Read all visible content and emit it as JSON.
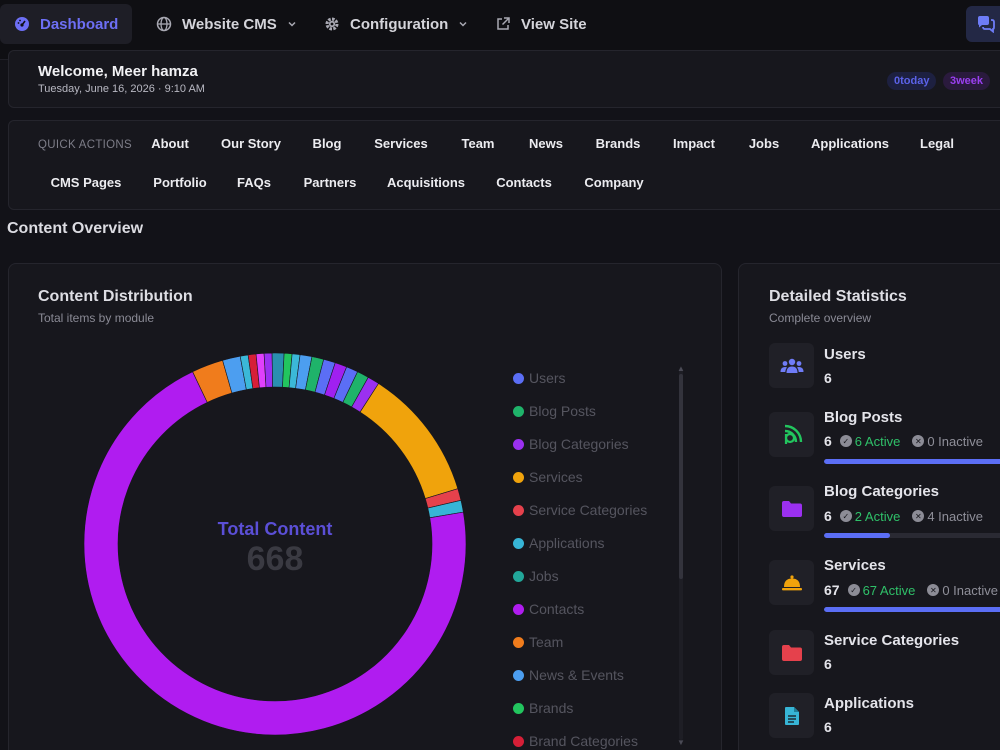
{
  "nav": {
    "items": [
      {
        "label": "Dashboard",
        "icon": "gauge-icon"
      },
      {
        "label": "Website CMS",
        "icon": "globe-icon"
      },
      {
        "label": "Configuration",
        "icon": "gear-icon"
      },
      {
        "label": "View Site",
        "icon": "external-link-icon"
      }
    ],
    "chat_icon": "comments-icon"
  },
  "welcome": {
    "name": "Welcome, Meer hamza",
    "date": "Tuesday, June 16, 2026 · 9:10 AM",
    "badges": {
      "today": "0today",
      "week": "3week"
    }
  },
  "quick_actions": {
    "label": "QUICK ACTIONS",
    "row1": [
      "About",
      "Our Story",
      "Blog",
      "Services",
      "Team",
      "News",
      "Brands",
      "Impact",
      "Jobs",
      "Applications",
      "Legal"
    ],
    "row2": [
      "CMS Pages",
      "Portfolio",
      "FAQs",
      "Partners",
      "Acquisitions",
      "Contacts",
      "Company"
    ]
  },
  "section_title": "Content Overview",
  "distribution": {
    "title": "Content Distribution",
    "subtitle": "Total items by module",
    "center_label": "Total Content",
    "center_value": "668"
  },
  "chart_data": {
    "type": "pie",
    "categories": [
      "Users",
      "Blog Posts",
      "Blog Categories",
      "Services",
      "Service Categories",
      "Applications",
      "Jobs",
      "Contacts",
      "Team",
      "News & Events",
      "Brands",
      "Brand Categories"
    ],
    "visible_legend": [
      "Users",
      "Blog Posts",
      "Blog Categories",
      "Services",
      "Service Categories",
      "Applications",
      "Jobs",
      "Contacts",
      "Team",
      "News & Events",
      "Brands",
      "Brand Categories"
    ],
    "legend_colors": [
      "#5b6ef5",
      "#1fb36a",
      "#9b30f0",
      "#f0a30c",
      "#e5414c",
      "#37b5d6",
      "#22a79a",
      "#b01cf0",
      "#f07c1c",
      "#4c9ef0",
      "#22c55e",
      "#d61f37"
    ],
    "segments": [
      {
        "value": 6,
        "color": "#5b6ef5"
      },
      {
        "value": 6,
        "color": "#1fb36a"
      },
      {
        "value": 6,
        "color": "#9b30f0"
      },
      {
        "value": 67,
        "color": "#f0a30c"
      },
      {
        "value": 6,
        "color": "#e5414c"
      },
      {
        "value": 6,
        "color": "#37b5d6"
      },
      {
        "value": 422,
        "color": "#b01cf0"
      },
      {
        "value": 16,
        "color": "#f07c1c"
      },
      {
        "value": 9,
        "color": "#4c9ef0"
      },
      {
        "value": 4,
        "color": "#3bb8d8"
      },
      {
        "value": 4,
        "color": "#d61f37"
      },
      {
        "value": 4,
        "color": "#e040fb"
      },
      {
        "value": 4,
        "color": "#9b30f0"
      },
      {
        "value": 6,
        "color": "#2a8fb0"
      },
      {
        "value": 4,
        "color": "#22c55e"
      },
      {
        "value": 4,
        "color": "#3bb8d8"
      },
      {
        "value": 6,
        "color": "#4c9ef0"
      },
      {
        "value": 6,
        "color": "#1fb36a"
      },
      {
        "value": 6,
        "color": "#5b6ef5"
      },
      {
        "value": 6,
        "color": "#a020f0"
      }
    ]
  },
  "stats": {
    "title": "Detailed Statistics",
    "subtitle": "Complete overview",
    "items": [
      {
        "name": "Users",
        "value": "6",
        "icon": "users-icon",
        "icon_color": "#6f7cf7"
      },
      {
        "name": "Blog Posts",
        "value": "6",
        "active": "6 Active",
        "inactive": "0 Inactive",
        "progress": 1.0,
        "icon": "blog-icon",
        "icon_color": "#22c55e"
      },
      {
        "name": "Blog Categories",
        "value": "6",
        "active": "2 Active",
        "inactive": "4 Inactive",
        "progress": 0.33,
        "icon": "folder-icon",
        "icon_color": "#9b30f0"
      },
      {
        "name": "Services",
        "value": "67",
        "active": "67 Active",
        "inactive": "0 Inactive",
        "progress": 1.0,
        "icon": "bell-icon",
        "icon_color": "#f0a30c"
      },
      {
        "name": "Service Categories",
        "value": "6",
        "icon": "folder-icon",
        "icon_color": "#e5414c"
      },
      {
        "name": "Applications",
        "value": "6",
        "icon": "document-icon",
        "icon_color": "#37b5d6"
      }
    ]
  }
}
